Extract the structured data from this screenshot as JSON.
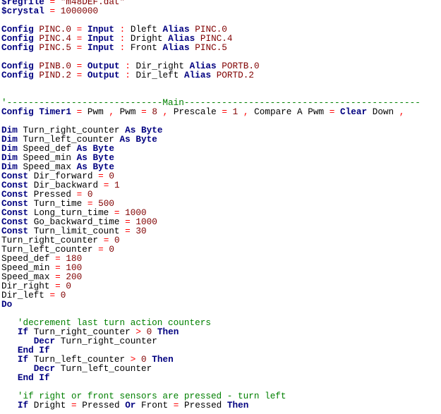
{
  "colors": {
    "background": "#ffffff",
    "keyword": "#000080",
    "operator": "#ff0000",
    "string": "#800000",
    "comment": "#008000",
    "identifier": "#000000"
  },
  "code_lines": [
    [
      [
        "kw",
        "$regfile"
      ],
      [
        "ws",
        " "
      ],
      [
        "op",
        "="
      ],
      [
        "ws",
        " "
      ],
      [
        "str",
        "\"m48DEF.dat\""
      ]
    ],
    [
      [
        "kw",
        "$crystal"
      ],
      [
        "ws",
        " "
      ],
      [
        "op",
        "="
      ],
      [
        "ws",
        " "
      ],
      [
        "str",
        "1000000"
      ]
    ],
    [],
    [
      [
        "kw",
        "Config"
      ],
      [
        "ws",
        " "
      ],
      [
        "str",
        "PINC.0"
      ],
      [
        "ws",
        " "
      ],
      [
        "op",
        "="
      ],
      [
        "ws",
        " "
      ],
      [
        "kw",
        "Input"
      ],
      [
        "ws",
        " "
      ],
      [
        "op",
        ":"
      ],
      [
        "ws",
        " "
      ],
      [
        "id",
        "Dleft"
      ],
      [
        "ws",
        " "
      ],
      [
        "kw",
        "Alias"
      ],
      [
        "ws",
        " "
      ],
      [
        "str",
        "PINC.0"
      ]
    ],
    [
      [
        "kw",
        "Config"
      ],
      [
        "ws",
        " "
      ],
      [
        "str",
        "PINC.4"
      ],
      [
        "ws",
        " "
      ],
      [
        "op",
        "="
      ],
      [
        "ws",
        " "
      ],
      [
        "kw",
        "Input"
      ],
      [
        "ws",
        " "
      ],
      [
        "op",
        ":"
      ],
      [
        "ws",
        " "
      ],
      [
        "id",
        "Dright"
      ],
      [
        "ws",
        " "
      ],
      [
        "kw",
        "Alias"
      ],
      [
        "ws",
        " "
      ],
      [
        "str",
        "PINC.4"
      ]
    ],
    [
      [
        "kw",
        "Config"
      ],
      [
        "ws",
        " "
      ],
      [
        "str",
        "PINC.5"
      ],
      [
        "ws",
        " "
      ],
      [
        "op",
        "="
      ],
      [
        "ws",
        " "
      ],
      [
        "kw",
        "Input"
      ],
      [
        "ws",
        " "
      ],
      [
        "op",
        ":"
      ],
      [
        "ws",
        " "
      ],
      [
        "id",
        "Front"
      ],
      [
        "ws",
        " "
      ],
      [
        "kw",
        "Alias"
      ],
      [
        "ws",
        " "
      ],
      [
        "str",
        "PINC.5"
      ]
    ],
    [],
    [
      [
        "kw",
        "Config"
      ],
      [
        "ws",
        " "
      ],
      [
        "str",
        "PINB.0"
      ],
      [
        "ws",
        " "
      ],
      [
        "op",
        "="
      ],
      [
        "ws",
        " "
      ],
      [
        "kw",
        "Output"
      ],
      [
        "ws",
        " "
      ],
      [
        "op",
        ":"
      ],
      [
        "ws",
        " "
      ],
      [
        "id",
        "Dir_right"
      ],
      [
        "ws",
        " "
      ],
      [
        "kw",
        "Alias"
      ],
      [
        "ws",
        " "
      ],
      [
        "str",
        "PORTB.0"
      ]
    ],
    [
      [
        "kw",
        "Config"
      ],
      [
        "ws",
        " "
      ],
      [
        "str",
        "PIND.2"
      ],
      [
        "ws",
        " "
      ],
      [
        "op",
        "="
      ],
      [
        "ws",
        " "
      ],
      [
        "kw",
        "Output"
      ],
      [
        "ws",
        " "
      ],
      [
        "op",
        ":"
      ],
      [
        "ws",
        " "
      ],
      [
        "id",
        "Dir_left"
      ],
      [
        "ws",
        " "
      ],
      [
        "kw",
        "Alias"
      ],
      [
        "ws",
        " "
      ],
      [
        "str",
        "PORTD.2"
      ]
    ],
    [],
    [],
    [
      [
        "cmt",
        "'-----------------------------Main--------------------------------------------"
      ]
    ],
    [
      [
        "kw",
        "Config"
      ],
      [
        "ws",
        " "
      ],
      [
        "kw",
        "Timer1"
      ],
      [
        "ws",
        " "
      ],
      [
        "op",
        "="
      ],
      [
        "ws",
        " "
      ],
      [
        "id",
        "Pwm"
      ],
      [
        "ws",
        " "
      ],
      [
        "op",
        ","
      ],
      [
        "ws",
        " "
      ],
      [
        "id",
        "Pwm"
      ],
      [
        "ws",
        " "
      ],
      [
        "op",
        "="
      ],
      [
        "ws",
        " "
      ],
      [
        "str",
        "8"
      ],
      [
        "ws",
        " "
      ],
      [
        "op",
        ","
      ],
      [
        "ws",
        " "
      ],
      [
        "id",
        "Prescale"
      ],
      [
        "ws",
        " "
      ],
      [
        "op",
        "="
      ],
      [
        "ws",
        " "
      ],
      [
        "str",
        "1"
      ],
      [
        "ws",
        " "
      ],
      [
        "op",
        ","
      ],
      [
        "ws",
        " "
      ],
      [
        "id",
        "Compare"
      ],
      [
        "ws",
        " "
      ],
      [
        "id",
        "A"
      ],
      [
        "ws",
        " "
      ],
      [
        "id",
        "Pwm"
      ],
      [
        "ws",
        " "
      ],
      [
        "op",
        "="
      ],
      [
        "ws",
        " "
      ],
      [
        "kw",
        "Clear"
      ],
      [
        "ws",
        " "
      ],
      [
        "id",
        "Down"
      ],
      [
        "ws",
        " "
      ],
      [
        "op",
        ","
      ]
    ],
    [],
    [
      [
        "kw",
        "Dim"
      ],
      [
        "ws",
        " "
      ],
      [
        "id",
        "Turn_right_counter"
      ],
      [
        "ws",
        " "
      ],
      [
        "kw",
        "As"
      ],
      [
        "ws",
        " "
      ],
      [
        "kw",
        "Byte"
      ]
    ],
    [
      [
        "kw",
        "Dim"
      ],
      [
        "ws",
        " "
      ],
      [
        "id",
        "Turn_left_counter"
      ],
      [
        "ws",
        " "
      ],
      [
        "kw",
        "As"
      ],
      [
        "ws",
        " "
      ],
      [
        "kw",
        "Byte"
      ]
    ],
    [
      [
        "kw",
        "Dim"
      ],
      [
        "ws",
        " "
      ],
      [
        "id",
        "Speed_def"
      ],
      [
        "ws",
        " "
      ],
      [
        "kw",
        "As"
      ],
      [
        "ws",
        " "
      ],
      [
        "kw",
        "Byte"
      ]
    ],
    [
      [
        "kw",
        "Dim"
      ],
      [
        "ws",
        " "
      ],
      [
        "id",
        "Speed_min"
      ],
      [
        "ws",
        " "
      ],
      [
        "kw",
        "As"
      ],
      [
        "ws",
        " "
      ],
      [
        "kw",
        "Byte"
      ]
    ],
    [
      [
        "kw",
        "Dim"
      ],
      [
        "ws",
        " "
      ],
      [
        "id",
        "Speed_max"
      ],
      [
        "ws",
        " "
      ],
      [
        "kw",
        "As"
      ],
      [
        "ws",
        " "
      ],
      [
        "kw",
        "Byte"
      ]
    ],
    [
      [
        "kw",
        "Const"
      ],
      [
        "ws",
        " "
      ],
      [
        "id",
        "Dir_forward"
      ],
      [
        "ws",
        " "
      ],
      [
        "op",
        "="
      ],
      [
        "ws",
        " "
      ],
      [
        "str",
        "0"
      ]
    ],
    [
      [
        "kw",
        "Const"
      ],
      [
        "ws",
        " "
      ],
      [
        "id",
        "Dir_backward"
      ],
      [
        "ws",
        " "
      ],
      [
        "op",
        "="
      ],
      [
        "ws",
        " "
      ],
      [
        "str",
        "1"
      ]
    ],
    [
      [
        "kw",
        "Const"
      ],
      [
        "ws",
        " "
      ],
      [
        "id",
        "Pressed"
      ],
      [
        "ws",
        " "
      ],
      [
        "op",
        "="
      ],
      [
        "ws",
        " "
      ],
      [
        "str",
        "0"
      ]
    ],
    [
      [
        "kw",
        "Const"
      ],
      [
        "ws",
        " "
      ],
      [
        "id",
        "Turn_time"
      ],
      [
        "ws",
        " "
      ],
      [
        "op",
        "="
      ],
      [
        "ws",
        " "
      ],
      [
        "str",
        "500"
      ]
    ],
    [
      [
        "kw",
        "Const"
      ],
      [
        "ws",
        " "
      ],
      [
        "id",
        "Long_turn_time"
      ],
      [
        "ws",
        " "
      ],
      [
        "op",
        "="
      ],
      [
        "ws",
        " "
      ],
      [
        "str",
        "1000"
      ]
    ],
    [
      [
        "kw",
        "Const"
      ],
      [
        "ws",
        " "
      ],
      [
        "id",
        "Go_backward_time"
      ],
      [
        "ws",
        " "
      ],
      [
        "op",
        "="
      ],
      [
        "ws",
        " "
      ],
      [
        "str",
        "1000"
      ]
    ],
    [
      [
        "kw",
        "Const"
      ],
      [
        "ws",
        " "
      ],
      [
        "id",
        "Turn_limit_count"
      ],
      [
        "ws",
        " "
      ],
      [
        "op",
        "="
      ],
      [
        "ws",
        " "
      ],
      [
        "str",
        "30"
      ]
    ],
    [
      [
        "id",
        "Turn_right_counter"
      ],
      [
        "ws",
        " "
      ],
      [
        "op",
        "="
      ],
      [
        "ws",
        " "
      ],
      [
        "str",
        "0"
      ]
    ],
    [
      [
        "id",
        "Turn_left_counter"
      ],
      [
        "ws",
        " "
      ],
      [
        "op",
        "="
      ],
      [
        "ws",
        " "
      ],
      [
        "str",
        "0"
      ]
    ],
    [
      [
        "id",
        "Speed_def"
      ],
      [
        "ws",
        " "
      ],
      [
        "op",
        "="
      ],
      [
        "ws",
        " "
      ],
      [
        "str",
        "180"
      ]
    ],
    [
      [
        "id",
        "Speed_min"
      ],
      [
        "ws",
        " "
      ],
      [
        "op",
        "="
      ],
      [
        "ws",
        " "
      ],
      [
        "str",
        "100"
      ]
    ],
    [
      [
        "id",
        "Speed_max"
      ],
      [
        "ws",
        " "
      ],
      [
        "op",
        "="
      ],
      [
        "ws",
        " "
      ],
      [
        "str",
        "200"
      ]
    ],
    [
      [
        "id",
        "Dir_right"
      ],
      [
        "ws",
        " "
      ],
      [
        "op",
        "="
      ],
      [
        "ws",
        " "
      ],
      [
        "str",
        "0"
      ]
    ],
    [
      [
        "id",
        "Dir_left"
      ],
      [
        "ws",
        " "
      ],
      [
        "op",
        "="
      ],
      [
        "ws",
        " "
      ],
      [
        "str",
        "0"
      ]
    ],
    [
      [
        "kw",
        "Do"
      ]
    ],
    [],
    [
      [
        "ws",
        "   "
      ],
      [
        "cmt",
        "'decrement last turn action counters"
      ]
    ],
    [
      [
        "ws",
        "   "
      ],
      [
        "kw",
        "If"
      ],
      [
        "ws",
        " "
      ],
      [
        "id",
        "Turn_right_counter"
      ],
      [
        "ws",
        " "
      ],
      [
        "op",
        ">"
      ],
      [
        "ws",
        " "
      ],
      [
        "str",
        "0"
      ],
      [
        "ws",
        " "
      ],
      [
        "kw",
        "Then"
      ]
    ],
    [
      [
        "ws",
        "      "
      ],
      [
        "kw",
        "Decr"
      ],
      [
        "ws",
        " "
      ],
      [
        "id",
        "Turn_right_counter"
      ]
    ],
    [
      [
        "ws",
        "   "
      ],
      [
        "kw",
        "End If"
      ]
    ],
    [
      [
        "ws",
        "   "
      ],
      [
        "kw",
        "If"
      ],
      [
        "ws",
        " "
      ],
      [
        "id",
        "Turn_left_counter"
      ],
      [
        "ws",
        " "
      ],
      [
        "op",
        ">"
      ],
      [
        "ws",
        " "
      ],
      [
        "str",
        "0"
      ],
      [
        "ws",
        " "
      ],
      [
        "kw",
        "Then"
      ]
    ],
    [
      [
        "ws",
        "      "
      ],
      [
        "kw",
        "Decr"
      ],
      [
        "ws",
        " "
      ],
      [
        "id",
        "Turn_left_counter"
      ]
    ],
    [
      [
        "ws",
        "   "
      ],
      [
        "kw",
        "End If"
      ]
    ],
    [],
    [
      [
        "ws",
        "   "
      ],
      [
        "cmt",
        "'if right or front sensors are pressed - turn left"
      ]
    ],
    [
      [
        "ws",
        "   "
      ],
      [
        "kw",
        "If"
      ],
      [
        "ws",
        " "
      ],
      [
        "id",
        "Dright"
      ],
      [
        "ws",
        " "
      ],
      [
        "op",
        "="
      ],
      [
        "ws",
        " "
      ],
      [
        "id",
        "Pressed"
      ],
      [
        "ws",
        " "
      ],
      [
        "kw",
        "Or"
      ],
      [
        "ws",
        " "
      ],
      [
        "id",
        "Front"
      ],
      [
        "ws",
        " "
      ],
      [
        "op",
        "="
      ],
      [
        "ws",
        " "
      ],
      [
        "id",
        "Pressed"
      ],
      [
        "ws",
        " "
      ],
      [
        "kw",
        "Then"
      ]
    ]
  ]
}
